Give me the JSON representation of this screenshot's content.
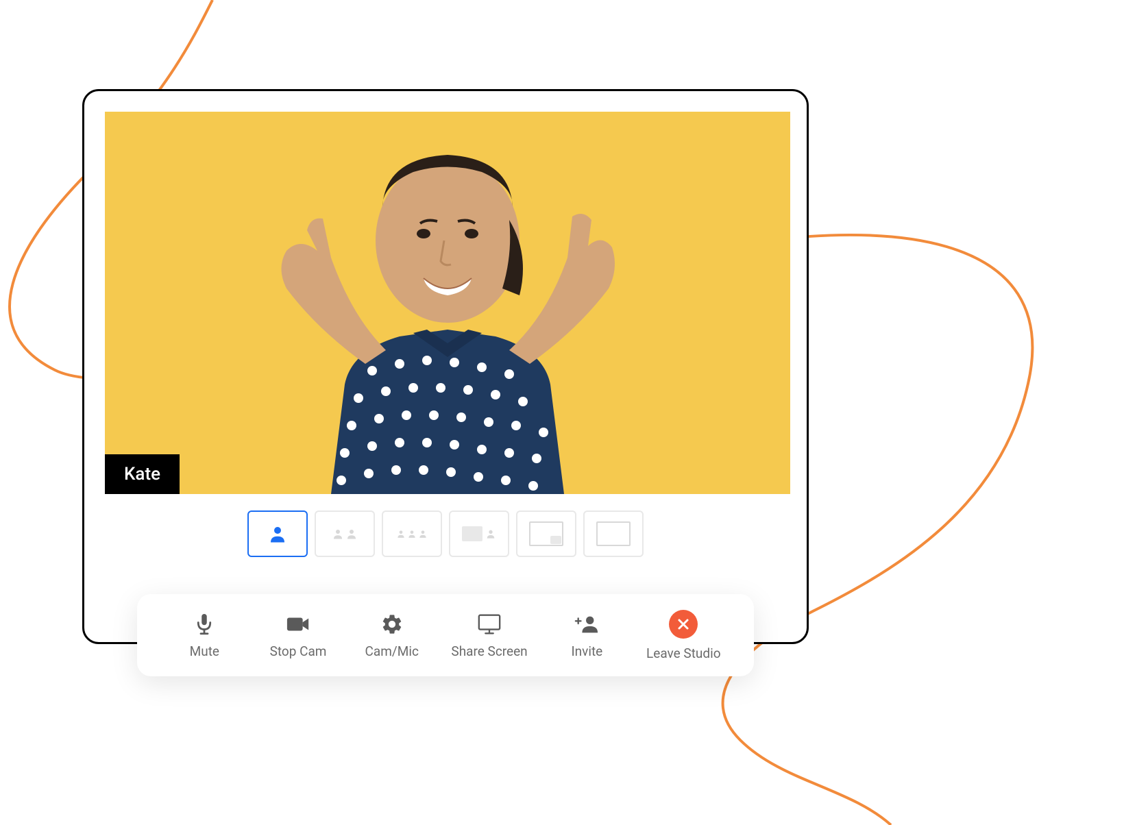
{
  "participant": {
    "name": "Kate"
  },
  "toolbar": {
    "mute_label": "Mute",
    "stop_cam_label": "Stop Cam",
    "cam_mic_label": "Cam/Mic",
    "share_screen_label": "Share Screen",
    "invite_label": "Invite",
    "leave_label": "Leave Studio"
  },
  "colors": {
    "accent_blue": "#1b6ef3",
    "video_bg": "#f5c94f",
    "leave_red": "#f25c3a",
    "decorative_orange": "#f28b3b"
  },
  "layout_options": {
    "active_index": 0,
    "count": 6
  }
}
